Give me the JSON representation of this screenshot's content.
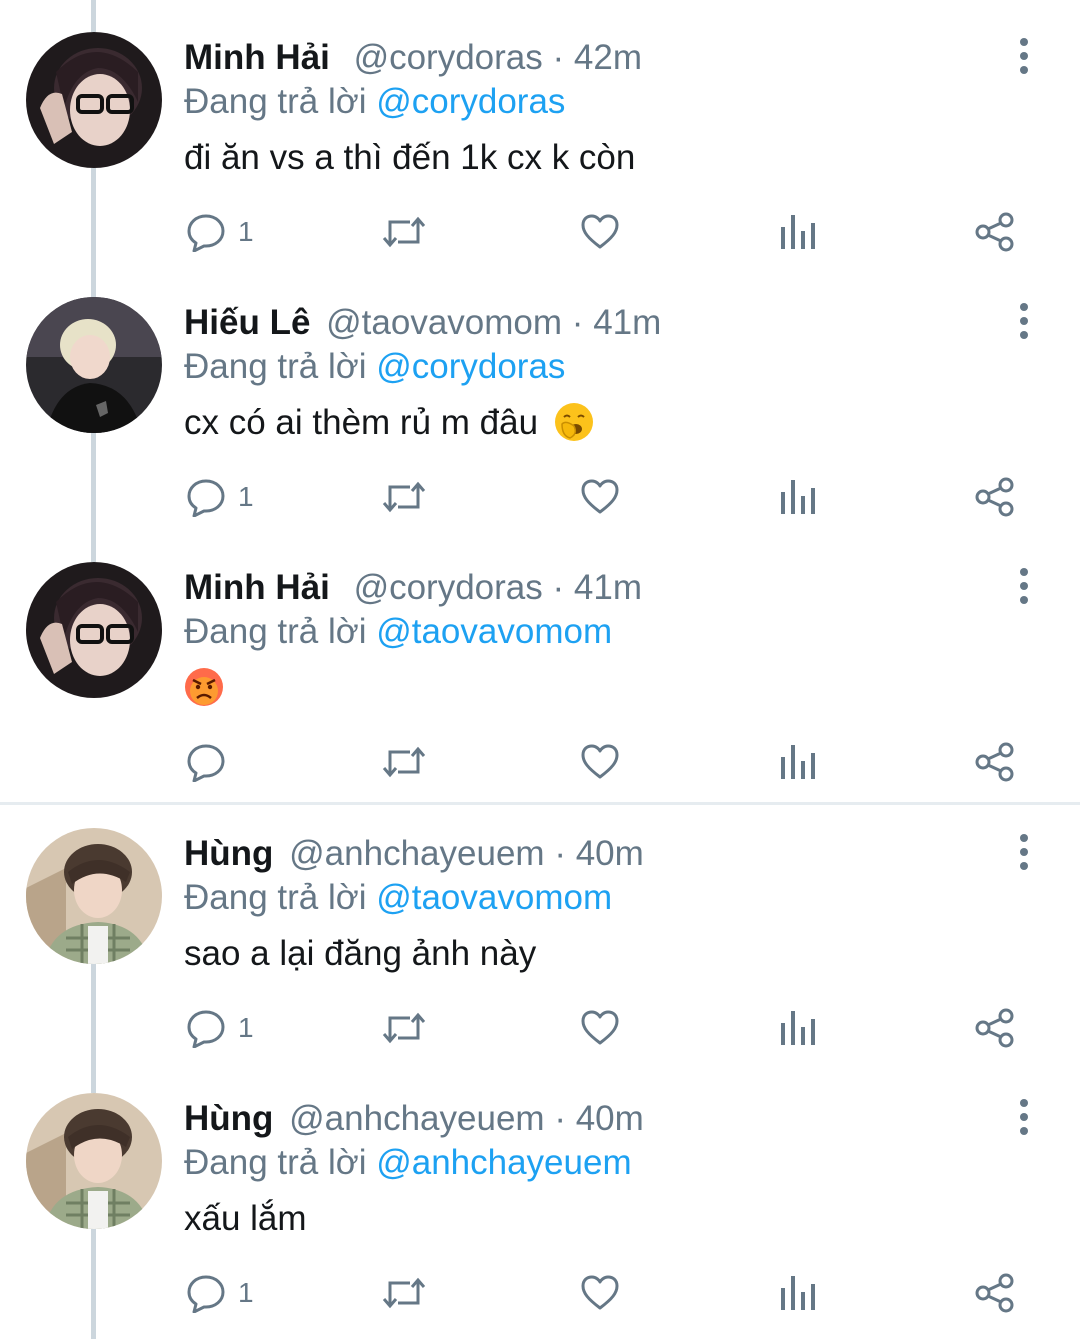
{
  "tweets": [
    {
      "name": "Minh Hải",
      "handle": "@corydoras",
      "time": "42m",
      "reply_prefix": "Đang trả lời",
      "reply_to": "@corydoras",
      "text": "đi ăn vs a thì đến 1k cx k còn",
      "emoji": "",
      "reply_count": "1",
      "avatar": "avatar-dark-hair-glasses"
    },
    {
      "name": "Hiếu Lê",
      "handle": "@taovavomom",
      "time": "41m",
      "reply_prefix": "Đang trả lời",
      "reply_to": "@corydoras",
      "text": "cx có ai thèm rủ m đâu",
      "emoji": "yawning-face",
      "reply_count": "1",
      "avatar": "avatar-blond-hair"
    },
    {
      "name": "Minh Hải",
      "handle": "@corydoras",
      "time": "41m",
      "reply_prefix": "Đang trả lời",
      "reply_to": "@taovavomom",
      "text": "",
      "emoji": "angry-face",
      "reply_count": "",
      "avatar": "avatar-dark-hair-glasses"
    },
    {
      "name": "Hùng",
      "handle": "@anhchayeuem",
      "time": "40m",
      "reply_prefix": "Đang trả lời",
      "reply_to": "@taovavomom",
      "text": "sao a lại đăng ảnh này",
      "emoji": "",
      "reply_count": "1",
      "avatar": "avatar-plaid-shirt"
    },
    {
      "name": "Hùng",
      "handle": "@anhchayeuem",
      "time": "40m",
      "reply_prefix": "Đang trả lời",
      "reply_to": "@anhchayeuem",
      "text": "xấu lắm",
      "emoji": "",
      "reply_count": "1",
      "avatar": "avatar-plaid-shirt"
    }
  ],
  "colors": {
    "accent": "#1da1f2",
    "secondary_text": "#657786",
    "icon": "#657786",
    "thread_line": "#ccd6dd"
  }
}
